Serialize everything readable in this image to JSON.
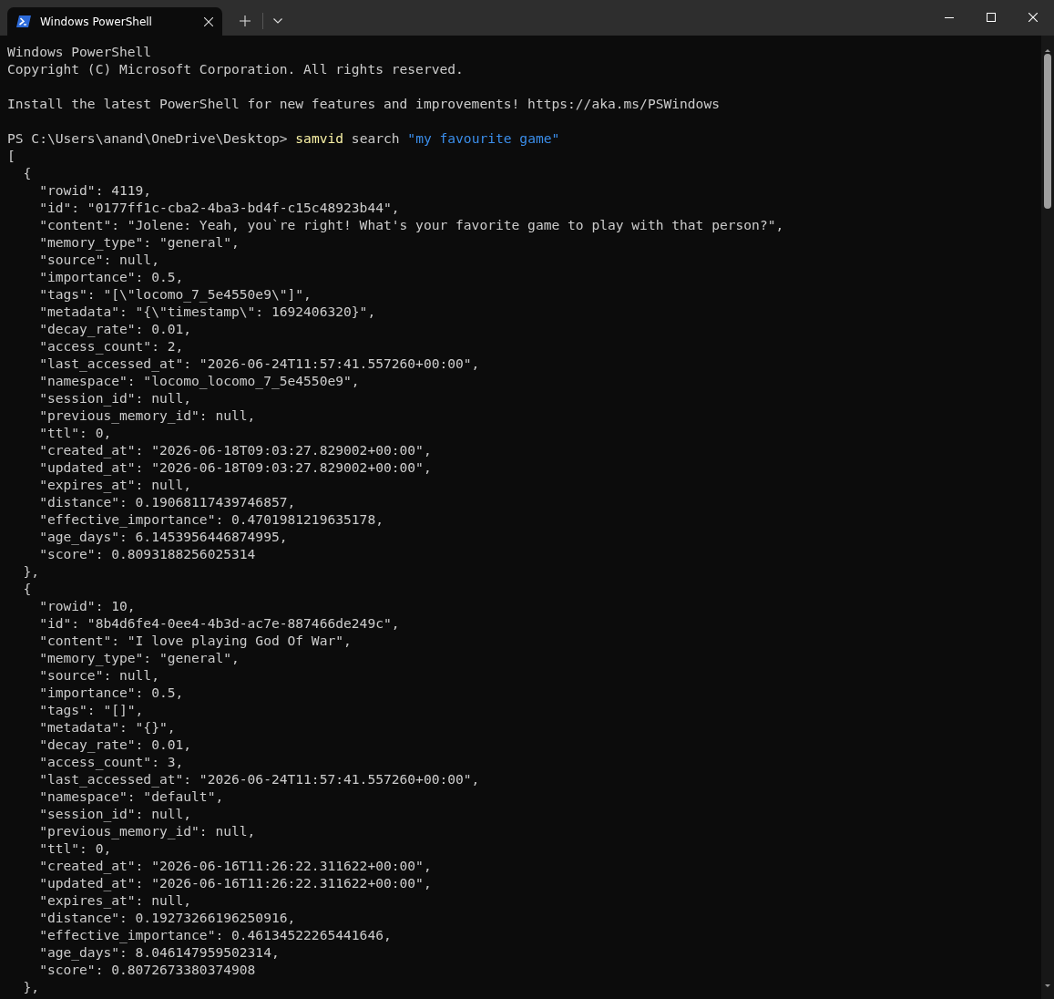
{
  "window": {
    "tabs": [
      {
        "title": "Windows PowerShell",
        "selected": true
      }
    ]
  },
  "terminal": {
    "banner": [
      "Windows PowerShell",
      "Copyright (C) Microsoft Corporation. All rights reserved."
    ],
    "notice": [
      "Install the latest PowerShell for new features and improvements! https://aka.ms/PSWindows"
    ],
    "prompt": {
      "location": "PS C:\\Users\\anand\\OneDrive\\Desktop>",
      "program": "samvid",
      "argument": "search",
      "query": "\"my favourite game\""
    },
    "output": [
      "[",
      "  {",
      "    \"rowid\": 4119,",
      "    \"id\": \"0177ff1c-cba2-4ba3-bd4f-c15c48923b44\",",
      "    \"content\": \"Jolene: Yeah, you`re right! What's your favorite game to play with that person?\",",
      "    \"memory_type\": \"general\",",
      "    \"source\": null,",
      "    \"importance\": 0.5,",
      "    \"tags\": \"[\\\"locomo_7_5e4550e9\\\"]\",",
      "    \"metadata\": \"{\\\"timestamp\\\": 1692406320}\",",
      "    \"decay_rate\": 0.01,",
      "    \"access_count\": 2,",
      "    \"last_accessed_at\": \"2026-06-24T11:57:41.557260+00:00\",",
      "    \"namespace\": \"locomo_locomo_7_5e4550e9\",",
      "    \"session_id\": null,",
      "    \"previous_memory_id\": null,",
      "    \"ttl\": 0,",
      "    \"created_at\": \"2026-06-18T09:03:27.829002+00:00\",",
      "    \"updated_at\": \"2026-06-18T09:03:27.829002+00:00\",",
      "    \"expires_at\": null,",
      "    \"distance\": 0.19068117439746857,",
      "    \"effective_importance\": 0.4701981219635178,",
      "    \"age_days\": 6.1453956446874995,",
      "    \"score\": 0.8093188256025314",
      "  },",
      "  {",
      "    \"rowid\": 10,",
      "    \"id\": \"8b4d6fe4-0ee4-4b3d-ac7e-887466de249c\",",
      "    \"content\": \"I love playing God Of War\",",
      "    \"memory_type\": \"general\",",
      "    \"source\": null,",
      "    \"importance\": 0.5,",
      "    \"tags\": \"[]\",",
      "    \"metadata\": \"{}\",",
      "    \"decay_rate\": 0.01,",
      "    \"access_count\": 3,",
      "    \"last_accessed_at\": \"2026-06-24T11:57:41.557260+00:00\",",
      "    \"namespace\": \"default\",",
      "    \"session_id\": null,",
      "    \"previous_memory_id\": null,",
      "    \"ttl\": 0,",
      "    \"created_at\": \"2026-06-16T11:26:22.311622+00:00\",",
      "    \"updated_at\": \"2026-06-16T11:26:22.311622+00:00\",",
      "    \"expires_at\": null,",
      "    \"distance\": 0.19273266196250916,",
      "    \"effective_importance\": 0.46134522265441646,",
      "    \"age_days\": 8.046147959502314,",
      "    \"score\": 0.8072673380374908",
      "  },"
    ]
  }
}
